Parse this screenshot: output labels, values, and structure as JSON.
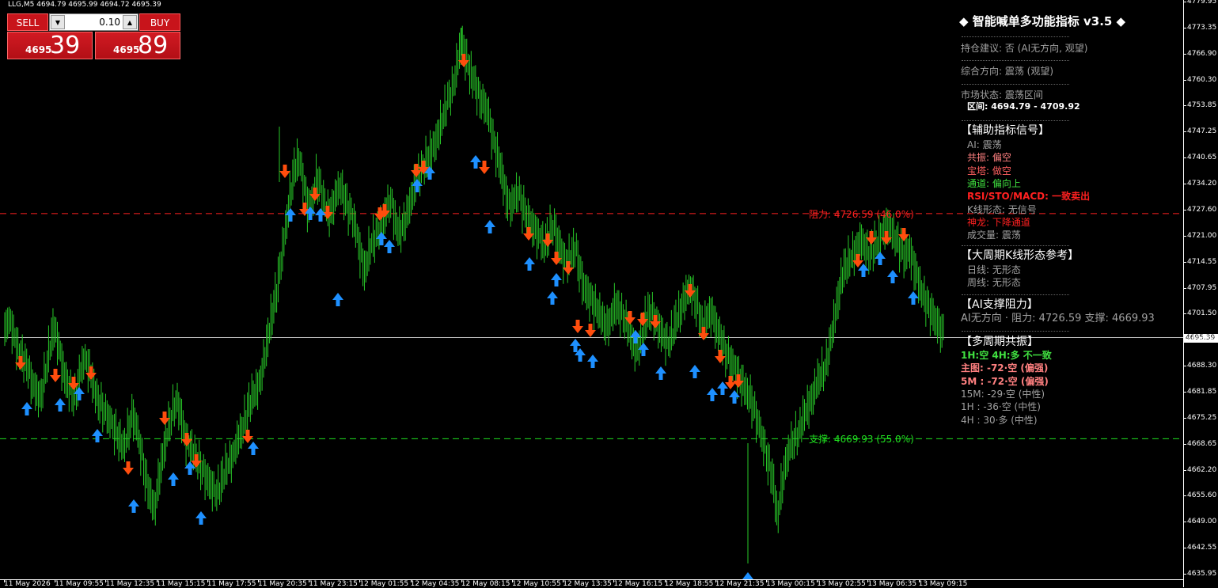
{
  "symbol_info": "LLG,M5   4694.79 4695.99 4694.72 4695.39",
  "trade_panel": {
    "sell_label": "SELL",
    "buy_label": "BUY",
    "lot": "0.10",
    "sell_price_small": "4695",
    "sell_price_big": "39",
    "buy_price_small": "4695",
    "buy_price_big": "89",
    "arrow_down": "▼",
    "arrow_up": "▲"
  },
  "indicator": {
    "title": "◆ 智能喊单多功能指标 v3.5 ◆",
    "position_advice": "持仓建议: 否 (AI无方向, 观望)",
    "direction": "综合方向: 震荡 (观望)",
    "market_state": "市场状态: 震荡区间",
    "range": "区间: 4694.79 - 4709.92",
    "aux_header": "【辅助指标信号】",
    "aux": [
      {
        "text": "AI: 震荡",
        "color": "#a0a0a0"
      },
      {
        "text": "共振: 偏空",
        "color": "#ff8080"
      },
      {
        "text": "宝塔: 做空",
        "color": "#ff6060"
      },
      {
        "text": "通道: 偏向上",
        "color": "#40e040"
      },
      {
        "text": "RSI/STO/MACD: 一致卖出",
        "color": "#ff2020"
      },
      {
        "text": "K线形态: 无信号",
        "color": "#a0a0a0"
      },
      {
        "text": "神龙: 下降通道",
        "color": "#ff2020"
      },
      {
        "text": "成交量: 震荡",
        "color": "#a0a0a0"
      }
    ],
    "big_period_header": "【大周期K线形态参考】",
    "daily": "日线: 无形态",
    "weekly": "周线: 无形态",
    "sr_header": "【AI支撑阻力】",
    "sr_line": "AI无方向 · 阻力: 4726.59    支撑: 4669.93",
    "multi_header": "【多周期共振】",
    "multi": [
      {
        "text": "1H:空 4H:多 不一致",
        "color": "#40e040"
      },
      {
        "text": "主图: -72·空 (偏强)",
        "color": "#ff8080"
      },
      {
        "text": "5M : -72·空 (偏强)",
        "color": "#ff8080"
      },
      {
        "text": "15M: -29·空 (中性)",
        "color": "#a0a0a0"
      },
      {
        "text": "1H : -36·空 (中性)",
        "color": "#a0a0a0"
      },
      {
        "text": "4H : 30·多 (中性)",
        "color": "#a0a0a0"
      }
    ]
  },
  "levels": {
    "resistance": {
      "label": "阻力: 4726.59 (46.0%)",
      "price": 4726.59,
      "color": "#ff2020"
    },
    "support": {
      "label": "支撑: 4669.93 (55.0%)",
      "price": 4669.93,
      "color": "#20e020"
    },
    "current_price": "4695.39",
    "current_price_value": 4695.39
  },
  "price_axis": [
    "4779.95",
    "4773.35",
    "4766.90",
    "4760.30",
    "4753.85",
    "4747.25",
    "4740.65",
    "4734.20",
    "4727.60",
    "4721.00",
    "4714.55",
    "4707.95",
    "4701.50",
    "4694.90",
    "4688.30",
    "4681.85",
    "4675.25",
    "4668.65",
    "4662.20",
    "4655.60",
    "4649.00",
    "4642.55",
    "4635.95"
  ],
  "time_axis": [
    "11 May 2026",
    "11 May 09:55",
    "11 May 12:35",
    "11 May 15:15",
    "11 May 17:55",
    "11 May 20:35",
    "11 May 23:15",
    "12 May 01:55",
    "12 May 04:35",
    "12 May 08:15",
    "12 May 10:55",
    "12 May 13:35",
    "12 May 16:15",
    "12 May 18:55",
    "12 May 21:35",
    "13 May 00:15",
    "13 May 02:55",
    "13 May 06:35",
    "13 May 09:15"
  ],
  "colors": {
    "candle": "#28c828",
    "sell_arrow": "#ff4d0d",
    "buy_arrow": "#1e90ff",
    "grid": "#fff"
  },
  "chart_data": {
    "type": "candlestick",
    "ylim": [
      4635.95,
      4779.95
    ],
    "closes": [
      4698,
      4700,
      4696,
      4692,
      4690,
      4688,
      4684,
      4682,
      4680,
      4686,
      4692,
      4698,
      4694,
      4688,
      4684,
      4682,
      4680,
      4686,
      4690,
      4688,
      4684,
      4680,
      4678,
      4676,
      4674,
      4672,
      4670,
      4668,
      4672,
      4676,
      4672,
      4666,
      4660,
      4656,
      4652,
      4660,
      4666,
      4672,
      4676,
      4680,
      4676,
      4670,
      4668,
      4666,
      4664,
      4662,
      4660,
      4658,
      4656,
      4658,
      4662,
      4664,
      4666,
      4670,
      4672,
      4676,
      4680,
      4682,
      4684,
      4690,
      4696,
      4702,
      4708,
      4716,
      4724,
      4732,
      4738,
      4740,
      4734,
      4728,
      4730,
      4736,
      4732,
      4728,
      4726,
      4730,
      4734,
      4732,
      4728,
      4726,
      4722,
      4716,
      4712,
      4718,
      4720,
      4722,
      4724,
      4728,
      4730,
      4724,
      4722,
      4724,
      4728,
      4732,
      4736,
      4738,
      4740,
      4742,
      4744,
      4748,
      4752,
      4756,
      4758,
      4764,
      4770,
      4766,
      4762,
      4760,
      4756,
      4754,
      4752,
      4746,
      4742,
      4738,
      4732,
      4728,
      4730,
      4732,
      4728,
      4726,
      4724,
      4722,
      4720,
      4718,
      4722,
      4724,
      4720,
      4716,
      4714,
      4716,
      4718,
      4712,
      4708,
      4706,
      4704,
      4702,
      4700,
      4698,
      4700,
      4704,
      4702,
      4700,
      4698,
      4694,
      4692,
      4696,
      4700,
      4702,
      4700,
      4698,
      4696,
      4694,
      4696,
      4700,
      4702,
      4706,
      4708,
      4706,
      4702,
      4698,
      4700,
      4702,
      4698,
      4696,
      4692,
      4690,
      4688,
      4686,
      4684,
      4682,
      4680,
      4676,
      4672,
      4668,
      4664,
      4660,
      4650,
      4658,
      4664,
      4668,
      4670,
      4672,
      4676,
      4678,
      4680,
      4684,
      4686,
      4688,
      4694,
      4700,
      4706,
      4712,
      4714,
      4716,
      4718,
      4720,
      4718,
      4716,
      4718,
      4720,
      4722,
      4724,
      4722,
      4720,
      4718,
      4716,
      4718,
      4714,
      4710,
      4706,
      4704,
      4702,
      4700,
      4698,
      4696
    ]
  }
}
